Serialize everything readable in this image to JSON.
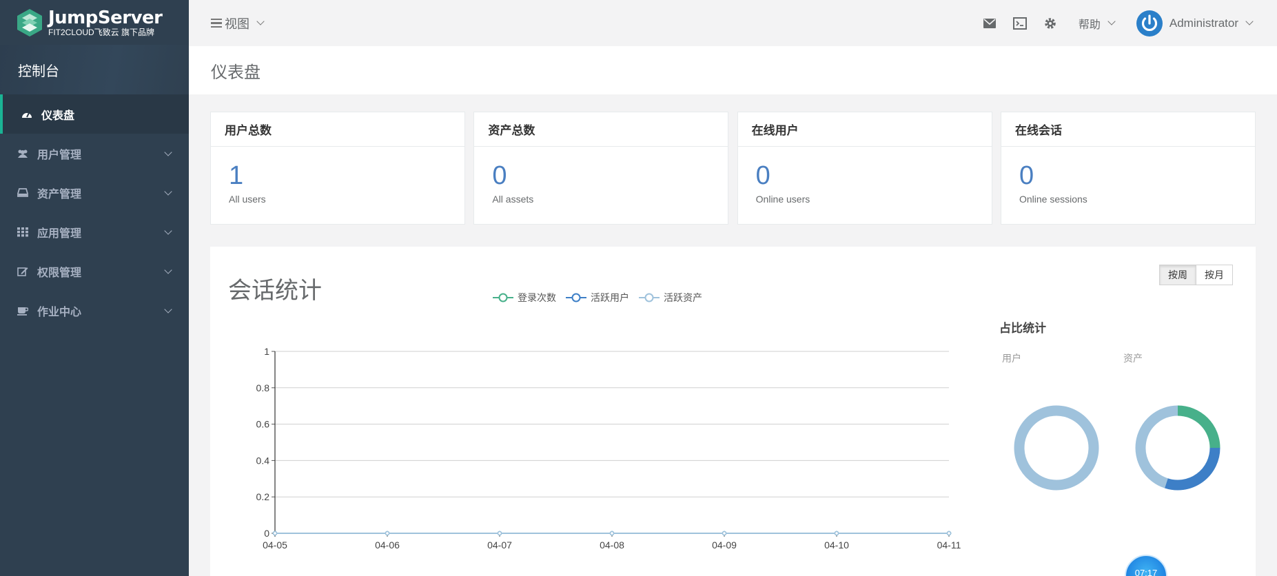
{
  "brand": {
    "title": "JumpServer",
    "subtitle": "FIT2CLOUD飞致云 旗下品牌"
  },
  "sidebar": {
    "console": "控制台",
    "items": [
      {
        "label": "仪表盘",
        "icon": "dashboard-icon",
        "active": true
      },
      {
        "label": "用户管理",
        "icon": "users-icon"
      },
      {
        "label": "资产管理",
        "icon": "hdd-icon"
      },
      {
        "label": "应用管理",
        "icon": "grid-icon"
      },
      {
        "label": "权限管理",
        "icon": "edit-icon"
      },
      {
        "label": "作业中心",
        "icon": "coffee-icon"
      }
    ]
  },
  "topbar": {
    "view_label": "视图",
    "help_label": "帮助",
    "user_name": "Administrator",
    "icons": [
      "mail-icon",
      "terminal-icon",
      "gear-icon"
    ]
  },
  "page_title": "仪表盘",
  "stats": [
    {
      "title": "用户总数",
      "value": "1",
      "sub": "All users"
    },
    {
      "title": "资产总数",
      "value": "0",
      "sub": "All assets"
    },
    {
      "title": "在线用户",
      "value": "0",
      "sub": "Online users"
    },
    {
      "title": "在线会话",
      "value": "0",
      "sub": "Online sessions"
    }
  ],
  "session_panel": {
    "title": "会话统计",
    "toggle": {
      "week": "按周",
      "month": "按月",
      "selected": "week"
    },
    "ratio_title": "占比统计",
    "donut_user_label": "用户",
    "donut_asset_label": "资产",
    "clock_text": "07:17"
  },
  "colors": {
    "login": "#47b08a",
    "active_user": "#3d7fc7",
    "active_asset": "#9fc2dc",
    "accent": "#1ab394",
    "stat_number": "#4a7fc1"
  },
  "chart_data": [
    {
      "type": "line",
      "title": "",
      "x": [
        "04-05",
        "04-06",
        "04-07",
        "04-08",
        "04-09",
        "04-10",
        "04-11"
      ],
      "series": [
        {
          "name": "登录次数",
          "values": [
            0,
            0,
            0,
            0,
            0,
            0,
            0
          ]
        },
        {
          "name": "活跃用户",
          "values": [
            0,
            0,
            0,
            0,
            0,
            0,
            0
          ]
        },
        {
          "name": "活跃资产",
          "values": [
            0,
            0,
            0,
            0,
            0,
            0,
            0
          ]
        }
      ],
      "y_ticks": [
        "0",
        "0.2",
        "0.4",
        "0.6",
        "0.8",
        "1"
      ],
      "ylim": [
        0,
        1
      ],
      "grid": true,
      "legend": "top-center"
    },
    {
      "type": "pie",
      "title": "用户",
      "slices": [
        {
          "label": "",
          "value": 1
        }
      ]
    },
    {
      "type": "pie",
      "title": "资产",
      "slices": [
        {
          "label": "",
          "value": 25
        },
        {
          "label": "",
          "value": 30
        },
        {
          "label": "",
          "value": 45
        }
      ]
    }
  ]
}
